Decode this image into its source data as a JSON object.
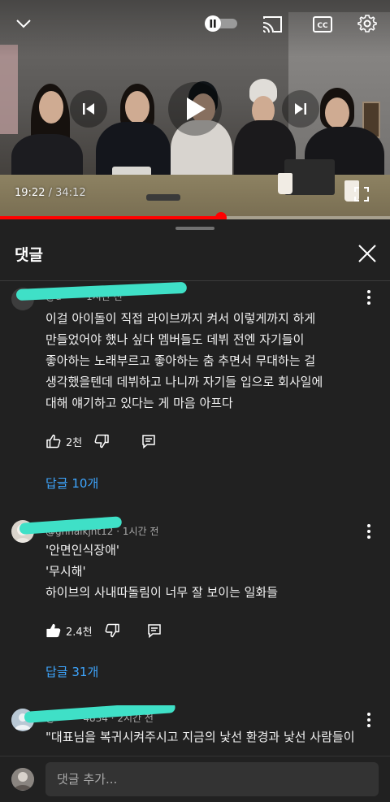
{
  "player": {
    "current_time": "19:22",
    "duration": "34:12",
    "progress": 0.566,
    "autoplay_paused": true,
    "icons": {
      "minimize": "chevron-down-icon",
      "autoplay": "pause-toggle-icon",
      "cast": "cast-icon",
      "captions": "cc-icon",
      "settings": "gear-icon",
      "previous": "skip-previous-icon",
      "play": "play-icon",
      "next": "skip-next-icon",
      "fullscreen": "fullscreen-icon"
    },
    "accent": "#ff0000"
  },
  "comments_panel": {
    "title": "댓글",
    "close_icon": "close-icon",
    "comments": [
      {
        "meta": "@u····· · 1시간 전",
        "lines": [
          "이걸 아이돌이 직접 라이브까지 켜서 이렇게까지 하게",
          "만들었어야 했나 싶다 멤버들도 데뷔 전엔 자기들이",
          "좋아하는 노래부르고 좋아하는 춤 추면서 무대하는 걸",
          "생각했을텐데 데뷔하고 나니까 자기들 입으로 회사일에",
          "대해 얘기하고 있다는 게 마음 아프다"
        ],
        "likes": "2천",
        "liked": false,
        "replies": "답글 10개"
      },
      {
        "meta": "@ghhalkjht12 · 1시간 전",
        "lines": [
          "'안면인식장애'",
          "'무시해'",
          "하이브의 사내따돌림이 너무 잘 보이는 일화들"
        ],
        "likes": "2.4천",
        "liked": true,
        "replies": "답글 31개"
      },
      {
        "meta": "@·········4834 · 2시간 전",
        "lines": [
          "\"대표님을 복귀시켜주시고 지금의 낯선 환경과 낯선 사람들이"
        ]
      }
    ]
  },
  "input": {
    "placeholder": "댓글 추가..."
  },
  "colors": {
    "link": "#3ea6ff",
    "sheet_bg": "#212121",
    "redaction": "#3fe0c7"
  }
}
